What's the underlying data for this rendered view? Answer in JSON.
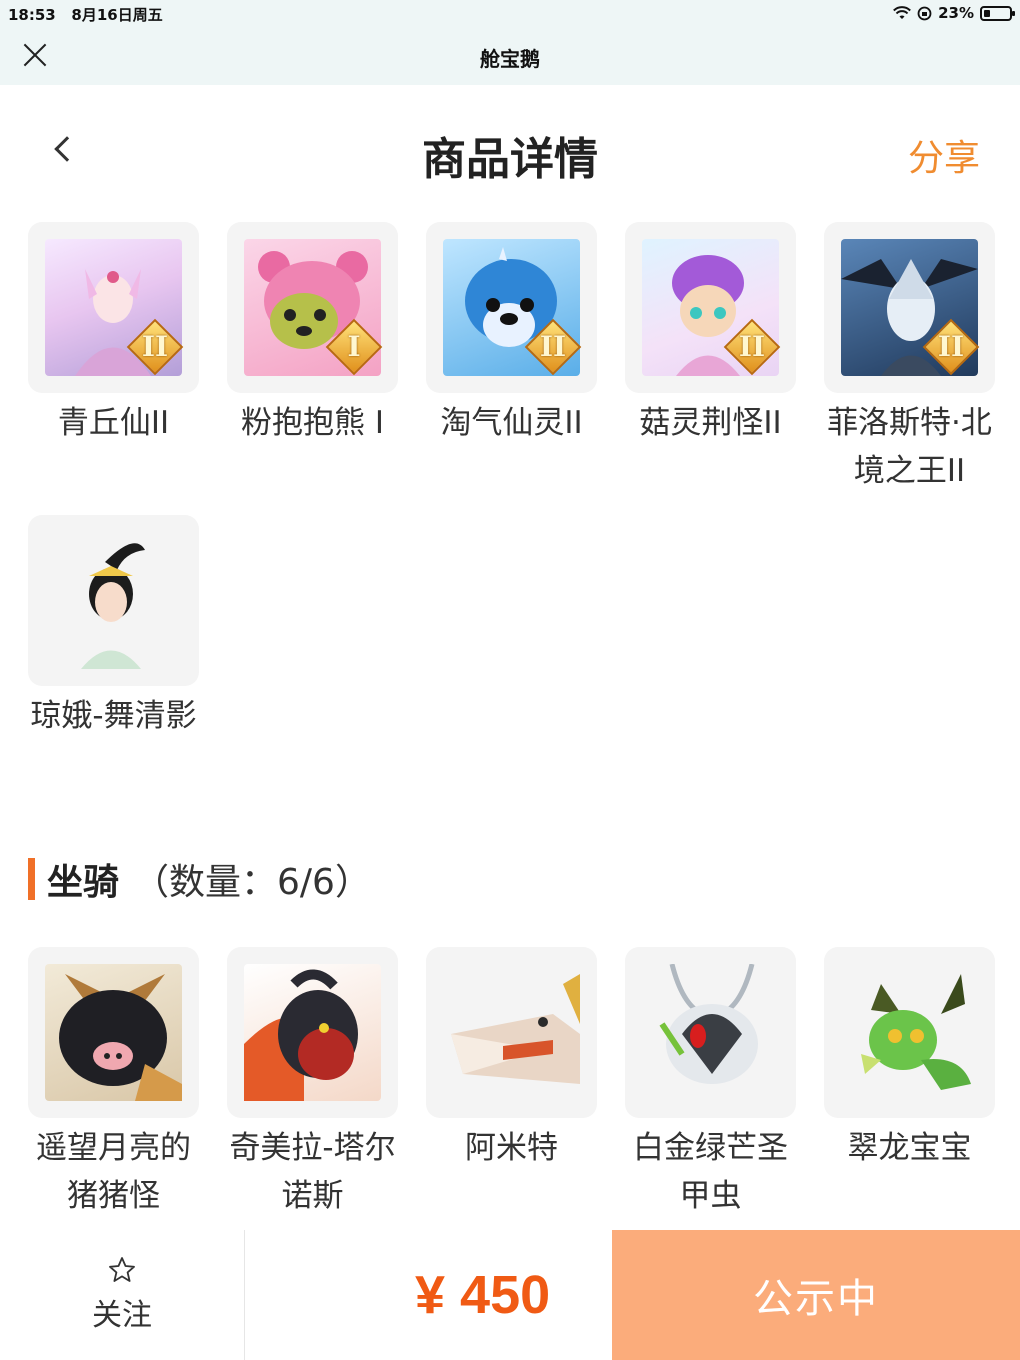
{
  "status_bar": {
    "time": "18:53",
    "date": "8月16日周五",
    "battery": "23%"
  },
  "app_bar": {
    "title": "舱宝鹅"
  },
  "header": {
    "title": "商品详情",
    "share_label": "分享"
  },
  "items": [
    {
      "name": "青丘仙II",
      "badge": "II",
      "art": "fox-fairy"
    },
    {
      "name": "粉抱抱熊 I",
      "badge": "I",
      "art": "pink-bear"
    },
    {
      "name": "淘气仙灵II",
      "badge": "II",
      "art": "blue-dog"
    },
    {
      "name": "菇灵荆怪II",
      "badge": "II",
      "art": "purple-elf"
    },
    {
      "name": "菲洛斯特·北境之王II",
      "badge": "II",
      "art": "ice-king"
    },
    {
      "name": "琼娥-舞清影",
      "badge": "",
      "art": "dancer"
    }
  ],
  "mount_section": {
    "title": "坐骑",
    "count": "（数量：6/6）"
  },
  "mounts": [
    {
      "name": "遥望月亮的猪猪怪",
      "art": "pig"
    },
    {
      "name": "奇美拉-塔尔诺斯",
      "art": "chimera"
    },
    {
      "name": "阿米特",
      "art": "crocodile"
    },
    {
      "name": "白金绿芒圣甲虫",
      "art": "beetle"
    },
    {
      "name": "翠龙宝宝",
      "art": "green-dragon"
    }
  ],
  "bottom_bar": {
    "follow_label": "关注",
    "price": "¥ 450",
    "status_label": "公示中"
  },
  "colors": {
    "accent": "#f07028",
    "share": "#f08c30",
    "price": "#f05a14",
    "status_button": "#fbac7b"
  }
}
